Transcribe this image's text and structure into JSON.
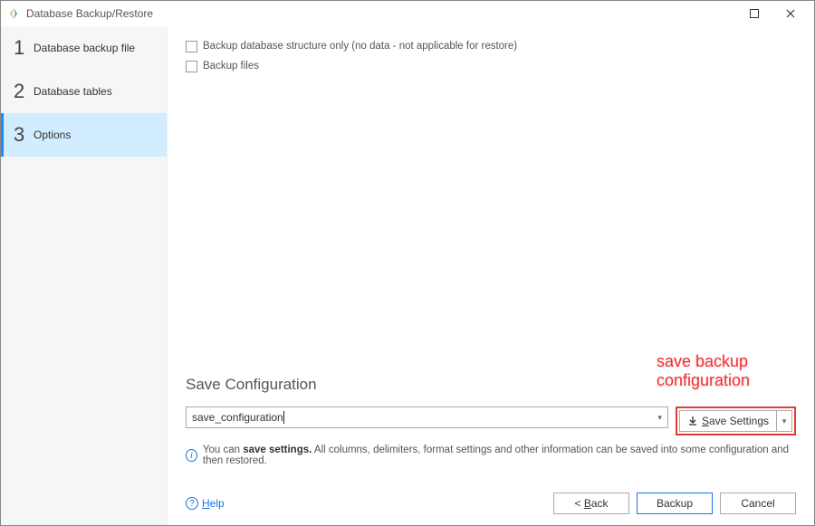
{
  "window": {
    "title": "Database Backup/Restore"
  },
  "sidebar": {
    "steps": [
      {
        "num": "1",
        "label": "Database backup file"
      },
      {
        "num": "2",
        "label": "Database tables"
      },
      {
        "num": "3",
        "label": "Options"
      }
    ]
  },
  "options": {
    "structure_only": "Backup database structure only (no data - not applicable for restore)",
    "backup_files": "Backup files"
  },
  "save_config": {
    "title": "Save Configuration",
    "input_value": "save_configuration",
    "save_button": "Save Settings",
    "info_prefix": "You can ",
    "info_bold": "save settings.",
    "info_rest": " All columns, delimiters, format settings and other information can be saved into some configuration and then restored."
  },
  "annotation": {
    "text": "save backup configuration"
  },
  "footer": {
    "help": "Help",
    "back": "< Back",
    "backup": "Backup",
    "cancel": "Cancel"
  }
}
